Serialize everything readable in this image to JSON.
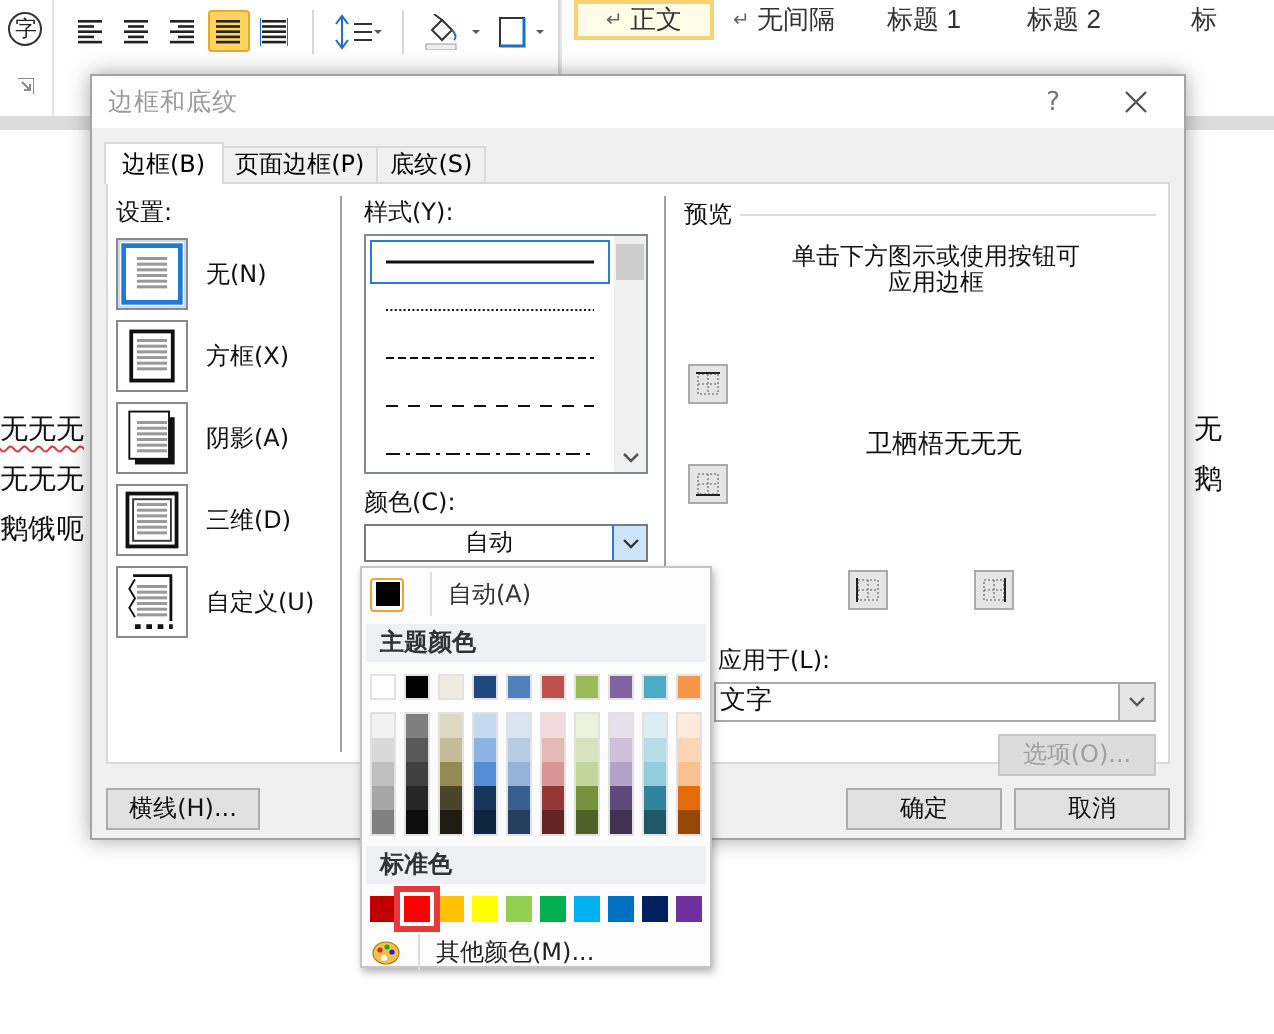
{
  "ribbon": {
    "font_char": "字",
    "alignment": [
      {
        "kind": "left",
        "selected": false
      },
      {
        "kind": "center",
        "selected": false
      },
      {
        "kind": "right",
        "selected": false
      },
      {
        "kind": "justify",
        "selected": true
      },
      {
        "kind": "distributed",
        "selected": false
      }
    ],
    "styles": [
      {
        "mark": "↵",
        "label": "正文",
        "selected": true
      },
      {
        "mark": "↵",
        "label": "无间隔",
        "selected": false
      },
      {
        "label": "标题 1",
        "selected": false
      },
      {
        "label": "标题 2",
        "selected": false
      },
      {
        "label": "标",
        "selected": false
      }
    ]
  },
  "document": {
    "left_lines": [
      {
        "text": "无无无",
        "spell_error": true
      },
      {
        "text": "无无无",
        "spell_error": false
      },
      {
        "text": "鹅饿呃",
        "spell_error": false
      }
    ],
    "right_lines": [
      {
        "text": "无",
        "spell_error": false
      },
      {
        "text": "鹅",
        "spell_error": false
      }
    ]
  },
  "dialog": {
    "title": "边框和底纹",
    "help": "?",
    "tabs": [
      {
        "label": "边框(B)",
        "selected": true
      },
      {
        "label": "页面边框(P)",
        "selected": false
      },
      {
        "label": "底纹(S)",
        "selected": false
      }
    ],
    "settings": {
      "label": "设置:",
      "items": [
        {
          "kind": "none",
          "label": "无(N)",
          "selected": true
        },
        {
          "kind": "box",
          "label": "方框(X)",
          "selected": false
        },
        {
          "kind": "shadow",
          "label": "阴影(A)",
          "selected": false
        },
        {
          "kind": "three-d",
          "label": "三维(D)",
          "selected": false
        },
        {
          "kind": "custom",
          "label": "自定义(U)",
          "selected": false
        }
      ]
    },
    "style": {
      "label": "样式(Y):",
      "lines": [
        {
          "kind": "solid",
          "selected": true
        },
        {
          "kind": "dotted",
          "selected": false
        },
        {
          "kind": "dashed",
          "selected": false
        },
        {
          "kind": "dashed-wide",
          "selected": false
        },
        {
          "kind": "dash-dot",
          "selected": false
        }
      ]
    },
    "color": {
      "label": "颜色(C):",
      "value": "自动",
      "expanded": true,
      "popup": {
        "auto_label": "自动(A)",
        "theme_heading": "主题颜色",
        "theme_colors": [
          {
            "color": "#ffffff",
            "shades": [
              {
                "color": "#f2f2f2"
              },
              {
                "color": "#d9d9d9"
              },
              {
                "color": "#bfbfbf"
              },
              {
                "color": "#a6a6a6"
              },
              {
                "color": "#808080"
              }
            ]
          },
          {
            "color": "#000000",
            "shades": [
              {
                "color": "#7f7f7f"
              },
              {
                "color": "#595959"
              },
              {
                "color": "#404040"
              },
              {
                "color": "#262626"
              },
              {
                "color": "#0d0d0d"
              }
            ]
          },
          {
            "color": "#eeece1",
            "shades": [
              {
                "color": "#ddd9c3"
              },
              {
                "color": "#c4bd97"
              },
              {
                "color": "#948a54"
              },
              {
                "color": "#4a452a"
              },
              {
                "color": "#1e1c11"
              }
            ]
          },
          {
            "color": "#1f497d",
            "shades": [
              {
                "color": "#c6d9f0"
              },
              {
                "color": "#8db3e2"
              },
              {
                "color": "#548dd4"
              },
              {
                "color": "#17365d"
              },
              {
                "color": "#0f243e"
              }
            ]
          },
          {
            "color": "#4f81bd",
            "shades": [
              {
                "color": "#dbe5f1"
              },
              {
                "color": "#b8cce4"
              },
              {
                "color": "#95b3d7"
              },
              {
                "color": "#366092"
              },
              {
                "color": "#244061"
              }
            ]
          },
          {
            "color": "#c0504d",
            "shades": [
              {
                "color": "#f2dcdb"
              },
              {
                "color": "#e5b9b7"
              },
              {
                "color": "#d99694"
              },
              {
                "color": "#953734"
              },
              {
                "color": "#632423"
              }
            ]
          },
          {
            "color": "#9bbb59",
            "shades": [
              {
                "color": "#ebf1dd"
              },
              {
                "color": "#d7e3bc"
              },
              {
                "color": "#c3d69b"
              },
              {
                "color": "#76923c"
              },
              {
                "color": "#4f6128"
              }
            ]
          },
          {
            "color": "#8064a2",
            "shades": [
              {
                "color": "#e5e0ec"
              },
              {
                "color": "#ccc1d9"
              },
              {
                "color": "#b2a2c7"
              },
              {
                "color": "#5f497a"
              },
              {
                "color": "#3f3151"
              }
            ]
          },
          {
            "color": "#4bacc6",
            "shades": [
              {
                "color": "#dbeef3"
              },
              {
                "color": "#b7dde8"
              },
              {
                "color": "#92cddc"
              },
              {
                "color": "#31859b"
              },
              {
                "color": "#205867"
              }
            ]
          },
          {
            "color": "#f79646",
            "shades": [
              {
                "color": "#fdeada"
              },
              {
                "color": "#fbd5b5"
              },
              {
                "color": "#fac08f"
              },
              {
                "color": "#e36c09"
              },
              {
                "color": "#974806"
              }
            ]
          }
        ],
        "standard_heading": "标准色",
        "standard_colors": [
          {
            "color": "#c00000",
            "selected": false
          },
          {
            "color": "#ff0000",
            "selected": true
          },
          {
            "color": "#ffc000",
            "selected": false
          },
          {
            "color": "#ffff00",
            "selected": false
          },
          {
            "color": "#92d050",
            "selected": false
          },
          {
            "color": "#00b050",
            "selected": false
          },
          {
            "color": "#00b0f0",
            "selected": false
          },
          {
            "color": "#0070c0",
            "selected": false
          },
          {
            "color": "#002060",
            "selected": false
          },
          {
            "color": "#7030a0",
            "selected": false
          }
        ],
        "more_label": "其他颜色(M)..."
      }
    },
    "preview": {
      "label": "预览",
      "hint": "单击下方图示或使用按钮可应用边框",
      "sample_text": "卫栖梧无无无"
    },
    "apply_to": {
      "label": "应用于(L):",
      "value": "文字"
    },
    "options_button": {
      "label": "选项(O)...",
      "disabled": true
    },
    "buttons": [
      {
        "label": "横线(H)..."
      },
      {
        "label": "确定"
      },
      {
        "label": "取消"
      }
    ]
  }
}
